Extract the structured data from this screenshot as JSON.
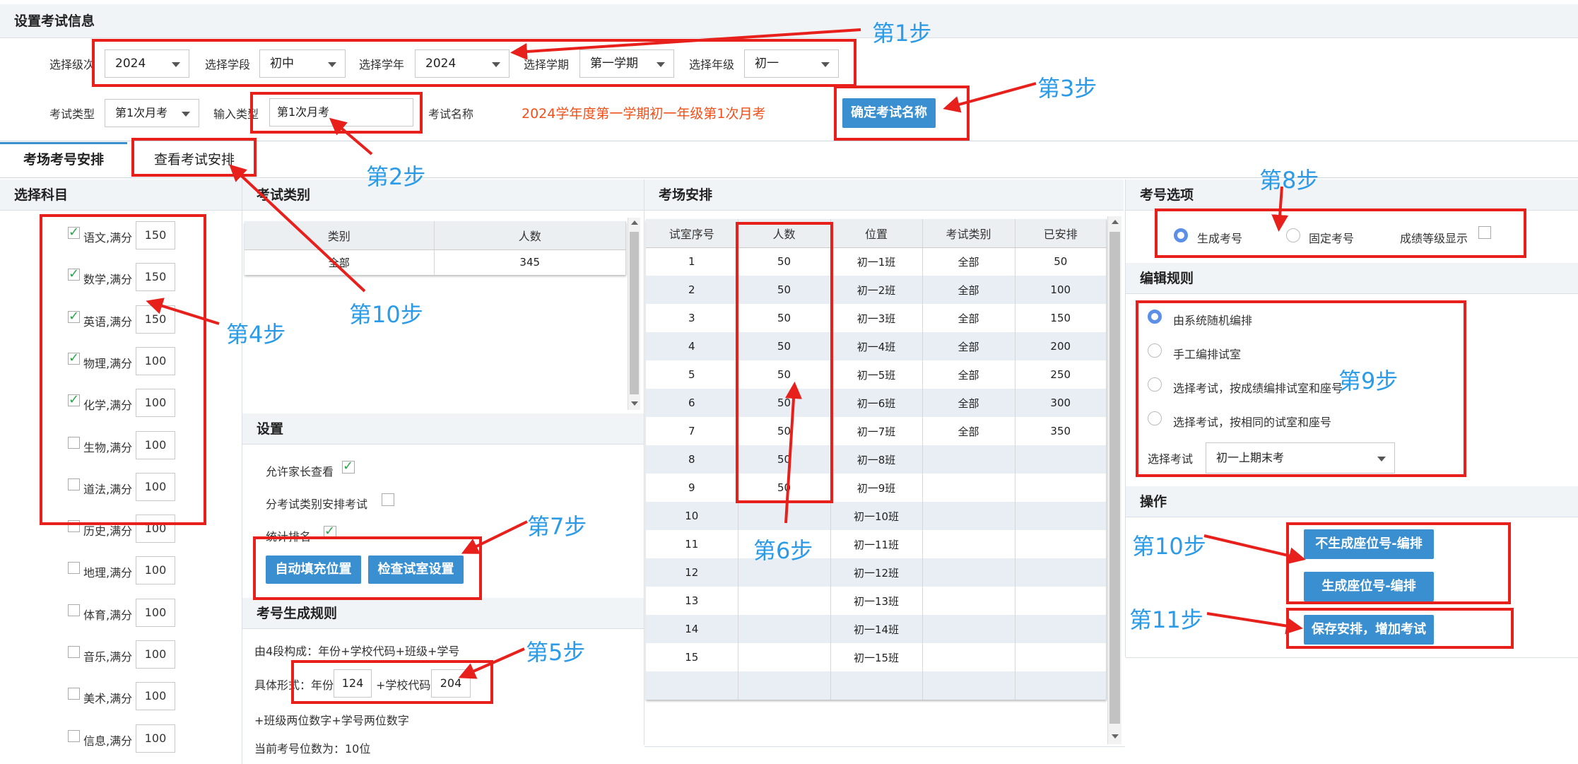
{
  "exam_info": {
    "title": "设置考试信息",
    "level_label": "选择级次",
    "level_value": "2024",
    "stage_label": "选择学段",
    "stage_value": "初中",
    "school_year_label": "选择学年",
    "school_year_value": "2024",
    "term_label": "选择学期",
    "term_value": "第一学期",
    "grade_label": "选择年级",
    "grade_value": "初一",
    "exam_type_label": "考试类型",
    "exam_type_value": "第1次月考",
    "input_type_label": "输入类型",
    "input_type_value": "第1次月考",
    "exam_name_label": "考试名称",
    "exam_name_value": "2024学年度第一学期初一年级第1次月考",
    "confirm_button": "确定考试名称"
  },
  "tabs": [
    {
      "label": "考场考号安排"
    },
    {
      "label": "查看考试安排"
    }
  ],
  "subjects": {
    "title": "选择科目",
    "items": [
      {
        "label": "语文,满分",
        "score": "150",
        "checked": true
      },
      {
        "label": "数学,满分",
        "score": "150",
        "checked": true
      },
      {
        "label": "英语,满分",
        "score": "150",
        "checked": true
      },
      {
        "label": "物理,满分",
        "score": "100",
        "checked": true
      },
      {
        "label": "化学,满分",
        "score": "100",
        "checked": true
      },
      {
        "label": "生物,满分",
        "score": "100",
        "checked": false
      },
      {
        "label": "道法,满分",
        "score": "100",
        "checked": false
      },
      {
        "label": "历史,满分",
        "score": "100",
        "checked": false
      },
      {
        "label": "地理,满分",
        "score": "100",
        "checked": false
      },
      {
        "label": "体育,满分",
        "score": "100",
        "checked": false
      },
      {
        "label": "音乐,满分",
        "score": "100",
        "checked": false
      },
      {
        "label": "美术,满分",
        "score": "100",
        "checked": false
      },
      {
        "label": "信息,满分",
        "score": "100",
        "checked": false
      }
    ]
  },
  "exam_category": {
    "title": "考试类别",
    "headers": [
      "类别",
      "人数"
    ],
    "rows": [
      [
        "全部",
        "345"
      ]
    ]
  },
  "settings": {
    "title": "设置",
    "allow_parent_label": "允许家长查看",
    "by_category_label": "分考试类别安排考试",
    "stat_rank_label": "统计排名",
    "auto_fill_button": "自动填充位置",
    "check_room_button": "检查试室设置"
  },
  "number_rule": {
    "title": "考号生成规则",
    "composition": "由4段构成：年份+学校代码+班级+学号",
    "form_label": "具体形式：年份",
    "year_value": "124",
    "school_code_label": "+学校代码",
    "school_code_value": "204",
    "suffix": "+班级两位数字+学号两位数字",
    "digits": "当前考号位数为：10位"
  },
  "room_arrangement": {
    "title": "考场安排",
    "headers": [
      "试室序号",
      "人数",
      "位置",
      "考试类别",
      "已安排"
    ],
    "rows": [
      [
        "1",
        "50",
        "初一1班",
        "全部",
        "50"
      ],
      [
        "2",
        "50",
        "初一2班",
        "全部",
        "100"
      ],
      [
        "3",
        "50",
        "初一3班",
        "全部",
        "150"
      ],
      [
        "4",
        "50",
        "初一4班",
        "全部",
        "200"
      ],
      [
        "5",
        "50",
        "初一5班",
        "全部",
        "250"
      ],
      [
        "6",
        "50",
        "初一6班",
        "全部",
        "300"
      ],
      [
        "7",
        "50",
        "初一7班",
        "全部",
        "350"
      ],
      [
        "8",
        "50",
        "初一8班",
        "",
        ""
      ],
      [
        "9",
        "50",
        "初一9班",
        "",
        ""
      ],
      [
        "10",
        "",
        "初一10班",
        "",
        ""
      ],
      [
        "11",
        "",
        "初一11班",
        "",
        ""
      ],
      [
        "12",
        "",
        "初一12班",
        "",
        ""
      ],
      [
        "13",
        "",
        "初一13班",
        "",
        ""
      ],
      [
        "14",
        "",
        "初一14班",
        "",
        ""
      ],
      [
        "15",
        "",
        "初一15班",
        "",
        ""
      ],
      [
        "",
        "",
        "",
        "",
        ""
      ]
    ]
  },
  "number_options": {
    "title": "考号选项",
    "generate_label": "生成考号",
    "fixed_label": "固定考号",
    "grade_display_label": "成绩等级显示"
  },
  "edit_rule": {
    "title": "编辑规则",
    "options": [
      "由系统随机编排",
      "手工编排试室",
      "选择考试，按成绩编排试室和座号",
      "选择考试，按相同的试室和座号"
    ],
    "select_exam_label": "选择考试",
    "select_exam_value": "初一上期末考"
  },
  "operations": {
    "title": "操作",
    "no_seat_button": "不生成座位号-编排",
    "seat_button": "生成座位号-编排",
    "save_button": "保存安排，增加考试"
  },
  "steps": [
    "第1步",
    "第2步",
    "第3步",
    "第4步",
    "第5步",
    "第6步",
    "第7步",
    "第8步",
    "第9步",
    "第10步",
    "第10步",
    "第11步"
  ],
  "colors": {
    "accent": "#3a8fd0",
    "annotation_red": "#e8201c",
    "step_blue": "#2b9be8",
    "exam_name_orange": "#f0501a"
  }
}
